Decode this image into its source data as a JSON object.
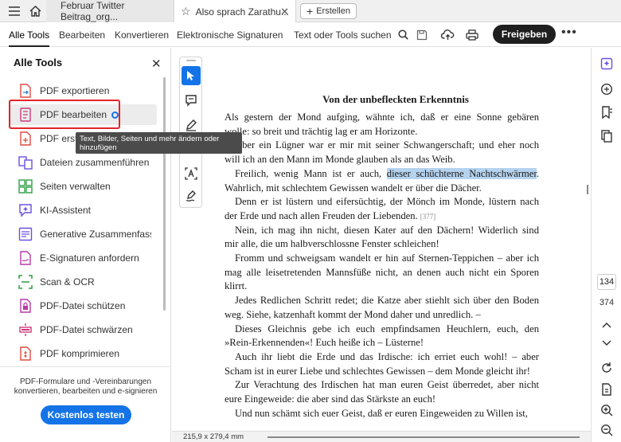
{
  "tabs": {
    "inactive_label": "Februar Twitter Beitrag_org...",
    "active_label": "Also sprach Zarathu...",
    "new_tab_label": "Erstellen"
  },
  "toolbar": {
    "menus": [
      "Alle Tools",
      "Bearbeiten",
      "Konvertieren",
      "Elektronische Signaturen"
    ],
    "search_label": "Text oder Tools suchen",
    "share_label": "Freigeben"
  },
  "left_panel": {
    "title": "Alle Tools",
    "items": [
      {
        "label": "PDF exportieren",
        "icon": "export-pdf-icon",
        "color": "#e04a3f"
      },
      {
        "label": "PDF bearbeiten",
        "icon": "edit-pdf-icon",
        "color": "#cc3a7a"
      },
      {
        "label": "PDF erstellen",
        "icon": "create-pdf-icon",
        "color": "#e04a3f"
      },
      {
        "label": "Dateien zusammenführen",
        "icon": "combine-files-icon",
        "color": "#6d4ee0"
      },
      {
        "label": "Seiten verwalten",
        "icon": "organize-pages-icon",
        "color": "#2f9e44"
      },
      {
        "label": "KI-Assistent",
        "icon": "ai-assistant-icon",
        "color": "#6d4ee0"
      },
      {
        "label": "Generative Zusammenfassung",
        "icon": "generative-summary-icon",
        "color": "#6d4ee0"
      },
      {
        "label": "E-Signaturen anfordern",
        "icon": "request-esign-icon",
        "color": "#b63aa8"
      },
      {
        "label": "Scan & OCR",
        "icon": "scan-ocr-icon",
        "color": "#2f9e44"
      },
      {
        "label": "PDF-Datei schützen",
        "icon": "protect-pdf-icon",
        "color": "#b63aa8"
      },
      {
        "label": "PDF-Datei schwärzen",
        "icon": "redact-pdf-icon",
        "color": "#cc3a7a"
      },
      {
        "label": "PDF komprimieren",
        "icon": "compress-pdf-icon",
        "color": "#e04a3f"
      }
    ],
    "tooltip": "Text, Bilder, Seiten und mehr ändern oder hinzufügen",
    "promo_text": "PDF-Formulare und -Vereinbarungen konvertieren, bearbeiten und e-signieren",
    "try_button": "Kostenlos testen"
  },
  "document": {
    "heading": "Von der unbefleckten Erkenntnis",
    "lines": [
      {
        "indent": false,
        "pre": "Als gestern der Mond aufging, wähnte ich, daß er eine Sonne gebären",
        "hl": "",
        "post": ""
      },
      {
        "indent": false,
        "pre": "wolle: so breit und trächtig lag er am Horizonte.",
        "hl": "",
        "post": ""
      },
      {
        "indent": true,
        "pre": "Aber ein Lügner war er mir mit seiner Schwangerschaft; und eher noch",
        "hl": "",
        "post": ""
      },
      {
        "indent": false,
        "pre": "will ich an den Mann im Monde glauben als an das Weib.",
        "hl": "",
        "post": ""
      },
      {
        "indent": true,
        "pre": "Freilich, wenig Mann ist er auch, ",
        "hl": "dieser schüchterne Nachtschwärmer",
        "post": "."
      },
      {
        "indent": false,
        "pre": "Wahrlich, mit schlechtem Gewissen wandelt er über die Dächer.",
        "hl": "",
        "post": ""
      },
      {
        "indent": true,
        "pre": "Denn er ist lüstern und eifersüchtig, der Mönch im Monde, lüstern nach",
        "hl": "",
        "post": ""
      },
      {
        "indent": false,
        "pre": "der Erde und nach allen Freuden der Liebenden.",
        "hl": "",
        "post": "",
        "ref": "[377]"
      },
      {
        "indent": true,
        "pre": "Nein, ich mag ihn nicht, diesen Kater auf den Dächern! Widerlich sind",
        "hl": "",
        "post": ""
      },
      {
        "indent": false,
        "pre": "mir alle, die um halbverschlossne Fenster schleichen!",
        "hl": "",
        "post": ""
      },
      {
        "indent": true,
        "pre": "Fromm und schweigsam wandelt er hin auf Sternen-Teppichen – aber ich",
        "hl": "",
        "post": ""
      },
      {
        "indent": false,
        "pre": "mag alle leisetretenden Mannsfüße nicht, an denen auch nicht ein Sporen",
        "hl": "",
        "post": ""
      },
      {
        "indent": false,
        "pre": "klirrt.",
        "hl": "",
        "post": ""
      },
      {
        "indent": true,
        "pre": "Jedes Redlichen Schritt redet; die Katze aber stiehlt sich über den Boden",
        "hl": "",
        "post": ""
      },
      {
        "indent": false,
        "pre": "weg. Siehe, katzenhaft kommt der Mond daher und unredlich. –",
        "hl": "",
        "post": ""
      },
      {
        "indent": true,
        "pre": "Dieses Gleichnis gebe ich euch empfindsamen Heuchlern, euch, den",
        "hl": "",
        "post": ""
      },
      {
        "indent": false,
        "pre": "»Rein-Erkennenden«! Euch heiße ich – Lüsterne!",
        "hl": "",
        "post": ""
      },
      {
        "indent": true,
        "pre": "Auch ihr liebt die Erde und das Irdische: ich erriet euch wohl! – aber",
        "hl": "",
        "post": ""
      },
      {
        "indent": false,
        "pre": "Scham ist in eurer Liebe und schlechtes Gewissen – dem Monde gleicht ihr!",
        "hl": "",
        "post": ""
      },
      {
        "indent": true,
        "pre": "Zur Verachtung des Irdischen hat man euren Geist überredet, aber nicht",
        "hl": "",
        "post": ""
      },
      {
        "indent": false,
        "pre": "eure Eingeweide: die aber sind das Stärkste an euch!",
        "hl": "",
        "post": ""
      },
      {
        "indent": true,
        "pre": "Und nun schämt sich euer Geist, daß er euren Eingeweiden zu Willen ist,",
        "hl": "",
        "post": ""
      }
    ]
  },
  "status": {
    "page_size": "215,9 x 279,4 mm"
  },
  "pager": {
    "current": "134",
    "total": "374"
  }
}
